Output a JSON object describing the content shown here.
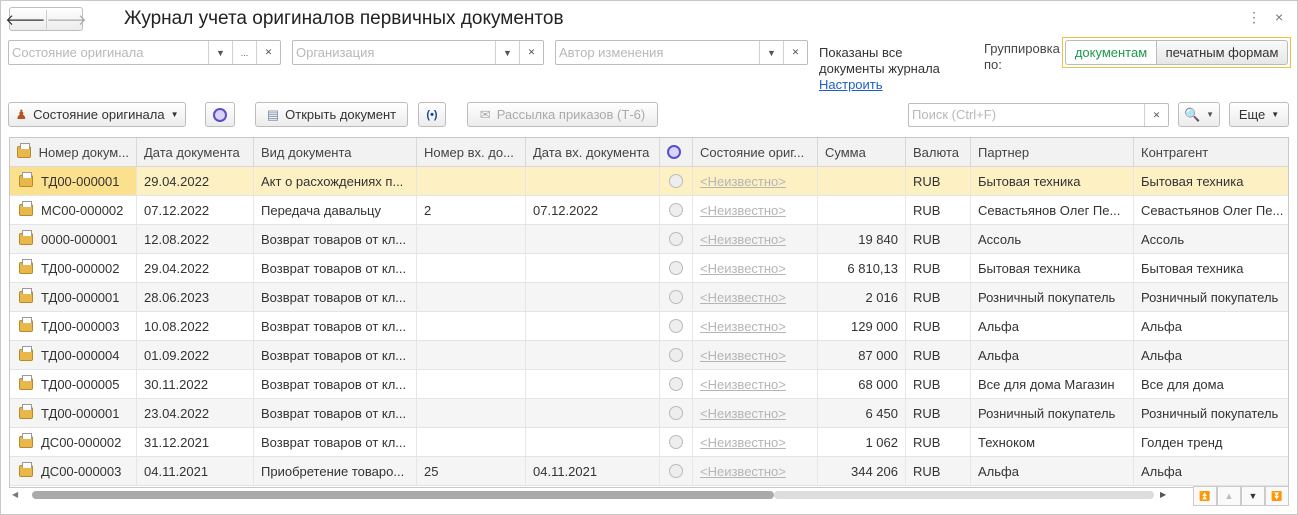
{
  "window": {
    "title": "Журнал учета оригиналов первичных документов"
  },
  "filters": {
    "state_placeholder": "Состояние оригинала",
    "org_placeholder": "Организация",
    "author_placeholder": "Автор изменения",
    "info_line1": "Показаны все",
    "info_line2": "документы журнала",
    "configure_link": "Настроить",
    "grouping_label1": "Группировка",
    "grouping_label2": "по:",
    "grouping_options": [
      "документам",
      "печатным формам"
    ]
  },
  "toolbar": {
    "state_button": "Состояние оригинала",
    "open_button": "Открыть документ",
    "mailing_button": "Рассылка приказов (Т-6)",
    "search_placeholder": "Поиск (Ctrl+F)",
    "more_button": "Еще"
  },
  "colors": {
    "accent_green": "#1a9a4a",
    "selected_row": "#fdf1c4",
    "link": "#1a5fc8"
  },
  "table": {
    "columns": [
      "Номер докум...",
      "Дата документа",
      "Вид документа",
      "Номер вх. до...",
      "Дата вх. документа",
      "",
      "Состояние ориг...",
      "Сумма",
      "Валюта",
      "Партнер",
      "Контрагент"
    ],
    "rows": [
      [
        "ТД00-000001",
        "29.04.2022",
        "Акт о расхождениях п...",
        "",
        "",
        "",
        "<Неизвестно>",
        "",
        "RUB",
        "Бытовая техника",
        "Бытовая техника"
      ],
      [
        "МС00-000002",
        "07.12.2022",
        "Передача давальцу",
        "2",
        "07.12.2022",
        "",
        "<Неизвестно>",
        "",
        "RUB",
        "Севастьянов Олег Пе...",
        "Севастьянов Олег Пе..."
      ],
      [
        "0000-000001",
        "12.08.2022",
        "Возврат товаров от кл...",
        "",
        "",
        "",
        "<Неизвестно>",
        "19 840",
        "RUB",
        "Ассоль",
        "Ассоль"
      ],
      [
        "ТД00-000002",
        "29.04.2022",
        "Возврат товаров от кл...",
        "",
        "",
        "",
        "<Неизвестно>",
        "6 810,13",
        "RUB",
        "Бытовая техника",
        "Бытовая техника"
      ],
      [
        "ТД00-000001",
        "28.06.2023",
        "Возврат товаров от кл...",
        "",
        "",
        "",
        "<Неизвестно>",
        "2 016",
        "RUB",
        "Розничный покупатель",
        "Розничный покупатель"
      ],
      [
        "ТД00-000003",
        "10.08.2022",
        "Возврат товаров от кл...",
        "",
        "",
        "",
        "<Неизвестно>",
        "129 000",
        "RUB",
        "Альфа",
        "Альфа"
      ],
      [
        "ТД00-000004",
        "01.09.2022",
        "Возврат товаров от кл...",
        "",
        "",
        "",
        "<Неизвестно>",
        "87 000",
        "RUB",
        "Альфа",
        "Альфа"
      ],
      [
        "ТД00-000005",
        "30.11.2022",
        "Возврат товаров от кл...",
        "",
        "",
        "",
        "<Неизвестно>",
        "68 000",
        "RUB",
        "Все для дома Магазин",
        "Все для дома"
      ],
      [
        "ТД00-000001",
        "23.04.2022",
        "Возврат товаров от кл...",
        "",
        "",
        "",
        "<Неизвестно>",
        "6 450",
        "RUB",
        "Розничный покупатель",
        "Розничный покупатель"
      ],
      [
        "ДС00-000002",
        "31.12.2021",
        "Возврат товаров от кл...",
        "",
        "",
        "",
        "<Неизвестно>",
        "1 062",
        "RUB",
        "Техноком",
        "Голден тренд"
      ],
      [
        "ДС00-000003",
        "04.11.2021",
        "Приобретение товаро...",
        "25",
        "04.11.2021",
        "",
        "<Неизвестно>",
        "344 206",
        "RUB",
        "Альфа",
        "Альфа"
      ]
    ]
  }
}
